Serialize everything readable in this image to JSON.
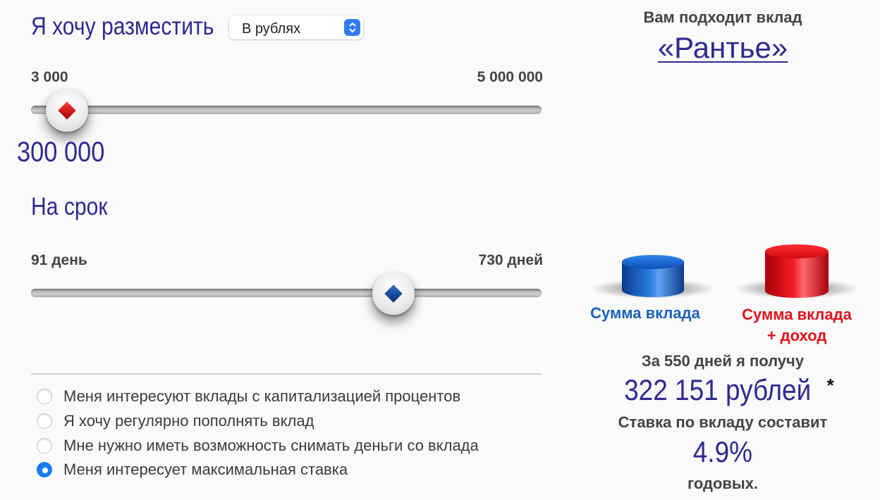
{
  "form": {
    "amount_heading": "Я хочу разместить",
    "currency_select": {
      "selected": "В рублях"
    },
    "amount_slider": {
      "min_label": "3 000",
      "max_label": "5 000 000",
      "value_label": "300 000",
      "position_fraction": 0.06
    },
    "term_heading": "На срок",
    "term_slider": {
      "min_label": "91 день",
      "max_label": "730 дней",
      "position_fraction": 0.71
    },
    "options": [
      {
        "label": "Меня интересуют вклады с капитализацией процентов",
        "selected": false
      },
      {
        "label": "Я хочу регулярно пополнять вклад",
        "selected": false
      },
      {
        "label": "Мне нужно иметь возможность снимать деньги со вклада",
        "selected": false
      },
      {
        "label": "Меня интересует максимальная ставка",
        "selected": true
      }
    ]
  },
  "result": {
    "title": "Вам подходит вклад",
    "deposit_name": "«Рантье»",
    "legend_deposit": "Сумма вклада",
    "legend_income_line1": "Сумма вклада",
    "legend_income_line2": "+ доход",
    "period_text": "За 550 дней я получу",
    "amount_text": "322 151 рублей",
    "footnote_mark": "*",
    "rate_caption": "Ставка по вкладу составит",
    "rate_value": "4.9%",
    "rate_unit": "годовых."
  },
  "colors": {
    "heading": "#2e2a8f",
    "blue_puck": "#1b62b8",
    "red_puck": "#e0121b",
    "radio_selected": "#1a7cf5"
  }
}
